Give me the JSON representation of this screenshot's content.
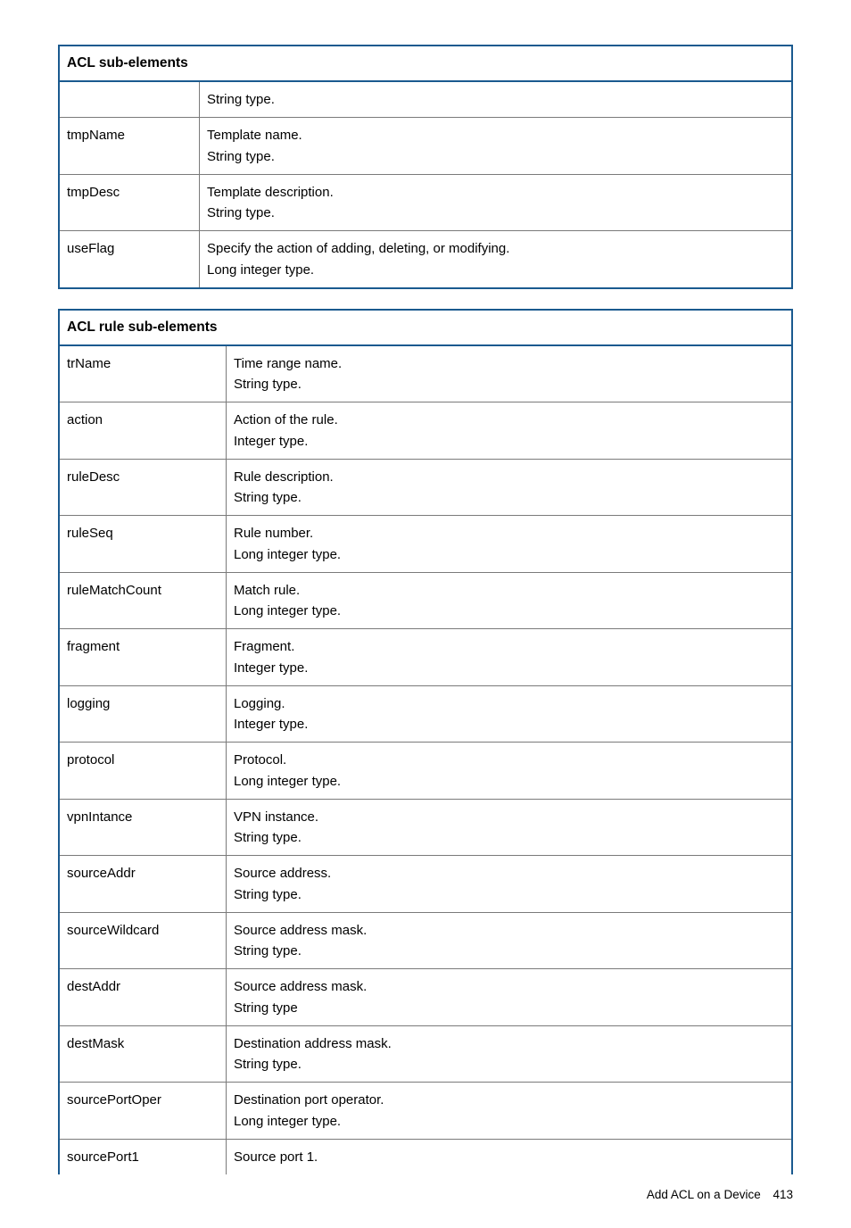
{
  "table1": {
    "caption": "ACL sub-elements",
    "rows": [
      {
        "name": "",
        "desc": "String type."
      },
      {
        "name": "tmpName",
        "desc": "Template name.\nString type."
      },
      {
        "name": "tmpDesc",
        "desc": "Template description.\nString type."
      },
      {
        "name": "useFlag",
        "desc": "Specify the action of adding, deleting, or modifying.\nLong integer type."
      }
    ]
  },
  "table2": {
    "caption": "ACL rule sub-elements",
    "rows": [
      {
        "name": "trName",
        "desc": "Time range name.\nString type."
      },
      {
        "name": "action",
        "desc": "Action of the rule.\nInteger type."
      },
      {
        "name": "ruleDesc",
        "desc": "Rule description.\nString type."
      },
      {
        "name": "ruleSeq",
        "desc": "Rule number.\nLong integer type."
      },
      {
        "name": "ruleMatchCount",
        "desc": "Match rule.\nLong integer type."
      },
      {
        "name": "fragment",
        "desc": "Fragment.\nInteger type."
      },
      {
        "name": "logging",
        "desc": "Logging.\nInteger type."
      },
      {
        "name": "protocol",
        "desc": "Protocol.\nLong integer type."
      },
      {
        "name": "vpnIntance",
        "desc": "VPN instance.\nString type."
      },
      {
        "name": "sourceAddr",
        "desc": "Source address.\nString type."
      },
      {
        "name": "sourceWildcard",
        "desc": "Source address mask.\nString type."
      },
      {
        "name": "destAddr",
        "desc": "Source address mask.\nString type"
      },
      {
        "name": "destMask",
        "desc": "Destination address mask.\nString type."
      },
      {
        "name": "sourcePortOper",
        "desc": "Destination port operator.\nLong integer type."
      },
      {
        "name": "sourcePort1",
        "desc": "Source port 1."
      }
    ]
  },
  "footer": {
    "section": "Add ACL on a Device",
    "page": "413"
  }
}
